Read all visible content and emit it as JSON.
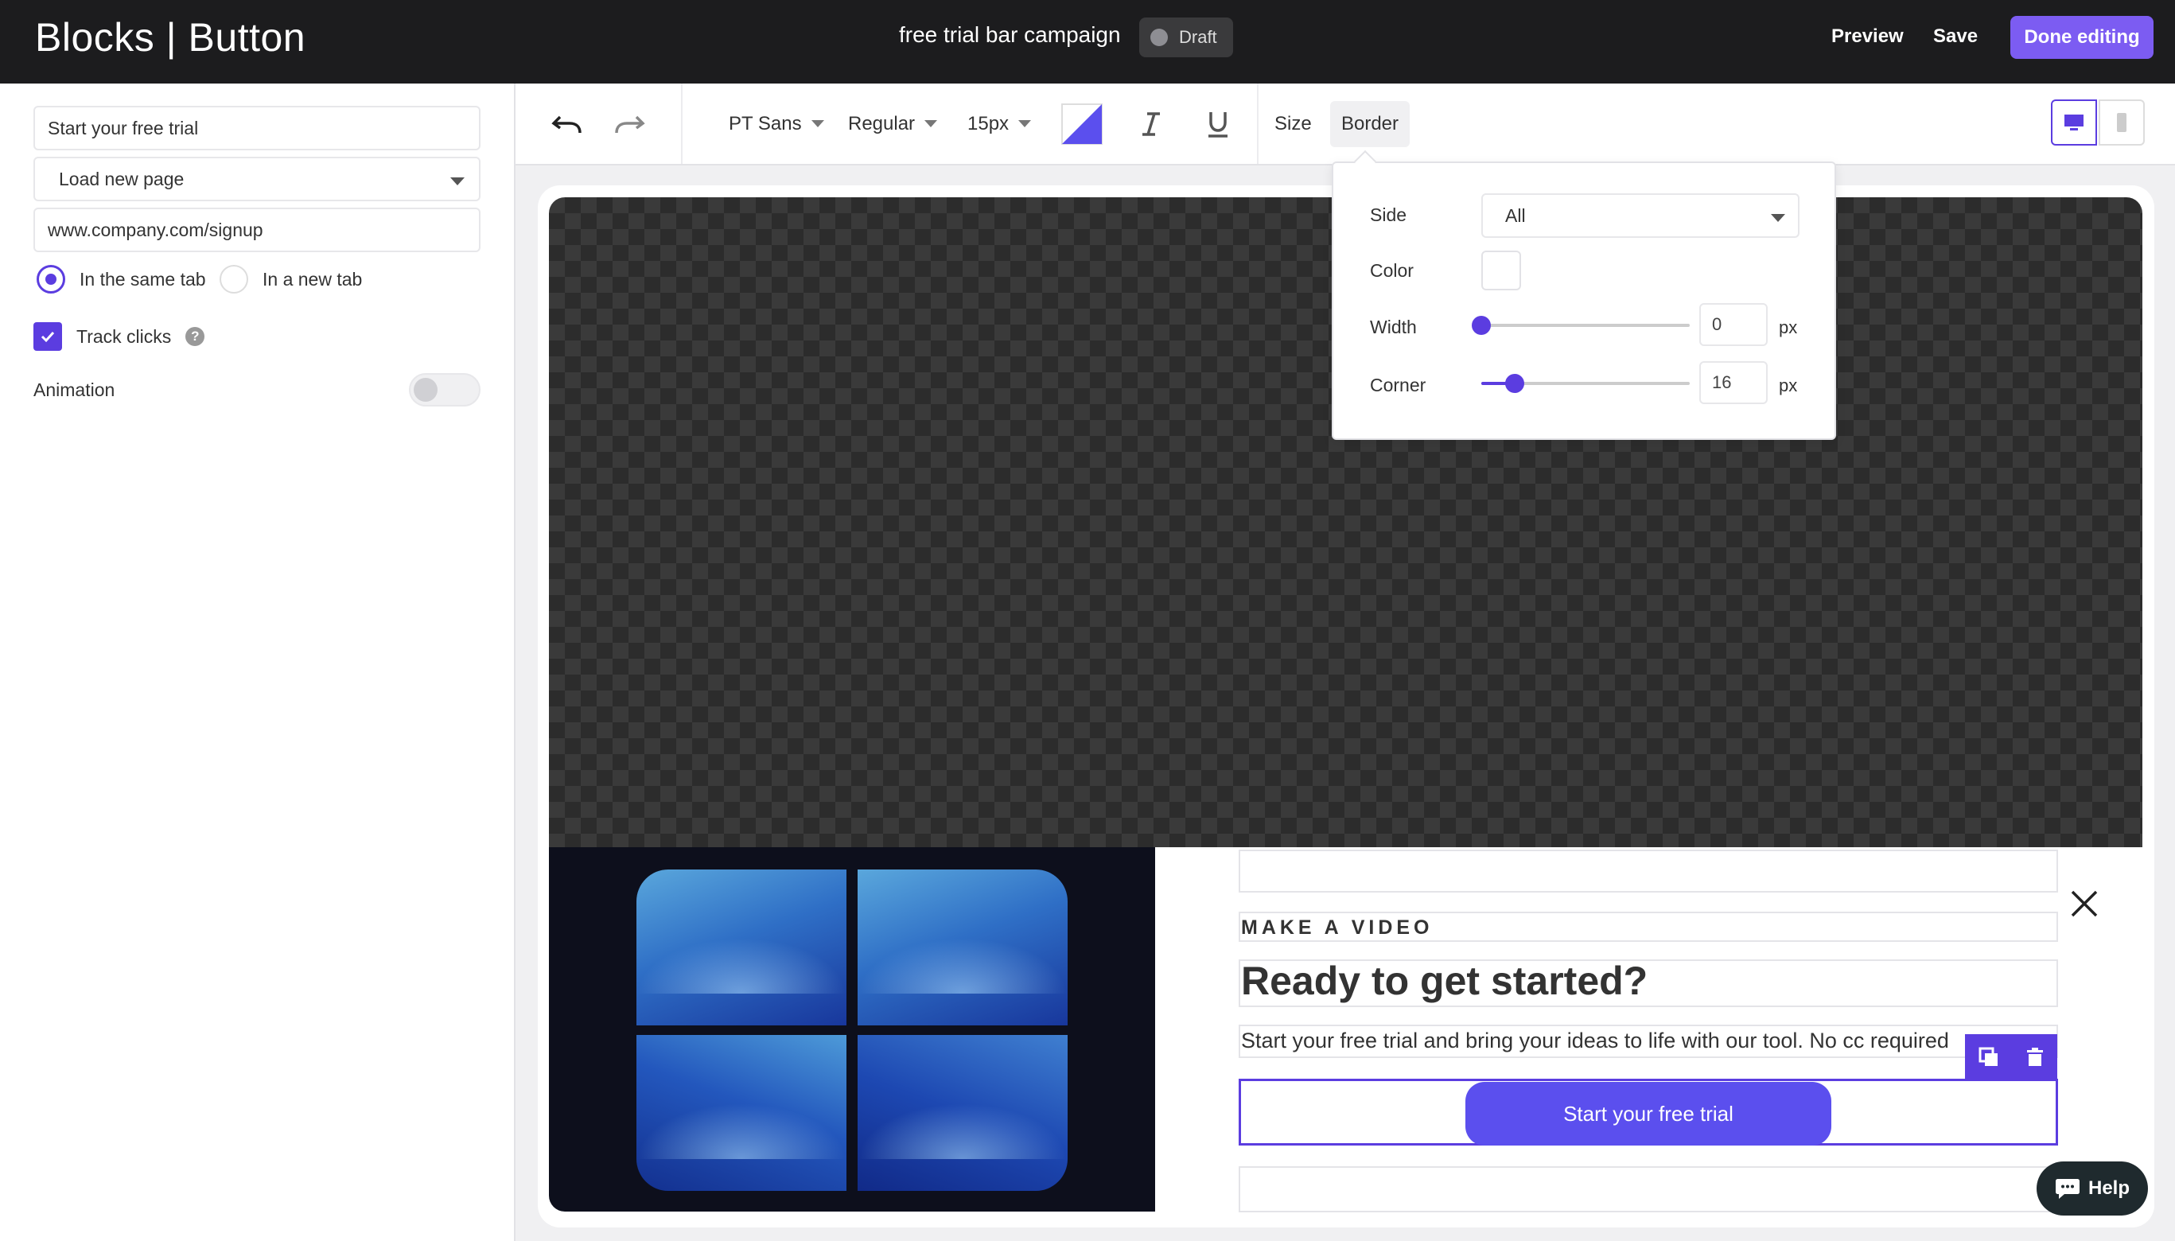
{
  "header": {
    "title": "Blocks | Button",
    "campaign_name": "free trial bar campaign",
    "status": "Draft",
    "preview_label": "Preview",
    "save_label": "Save",
    "done_label": "Done editing"
  },
  "left_panel": {
    "button_text": "Start your free trial",
    "action": "Load new page",
    "url": "www.company.com/signup",
    "radio_same_tab": "In the same tab",
    "radio_new_tab": "In a new tab",
    "track_clicks_label": "Track clicks",
    "help_mark": "?",
    "animation_label": "Animation"
  },
  "toolbar": {
    "font_family": "PT Sans",
    "font_weight": "Regular",
    "font_size": "15px",
    "size_tab": "Size",
    "border_tab": "Border"
  },
  "border_popup": {
    "side_label": "Side",
    "side_value": "All",
    "color_label": "Color",
    "width_label": "Width",
    "width_value": "0",
    "width_fraction": 0.0,
    "corner_label": "Corner",
    "corner_value": "16",
    "corner_fraction": 0.16,
    "unit": "px"
  },
  "canvas": {
    "eyebrow": "MAKE A VIDEO",
    "headline": "Ready to get started?",
    "body": "Start your free trial and bring your ideas to life with our tool. No cc required",
    "cta_label": "Start your free trial"
  },
  "help": {
    "label": "Help"
  },
  "colors": {
    "accent": "#5b3de0",
    "cta": "#5b4fee",
    "topbar": "#1c1c1e",
    "done_button": "#7c5cf2"
  }
}
